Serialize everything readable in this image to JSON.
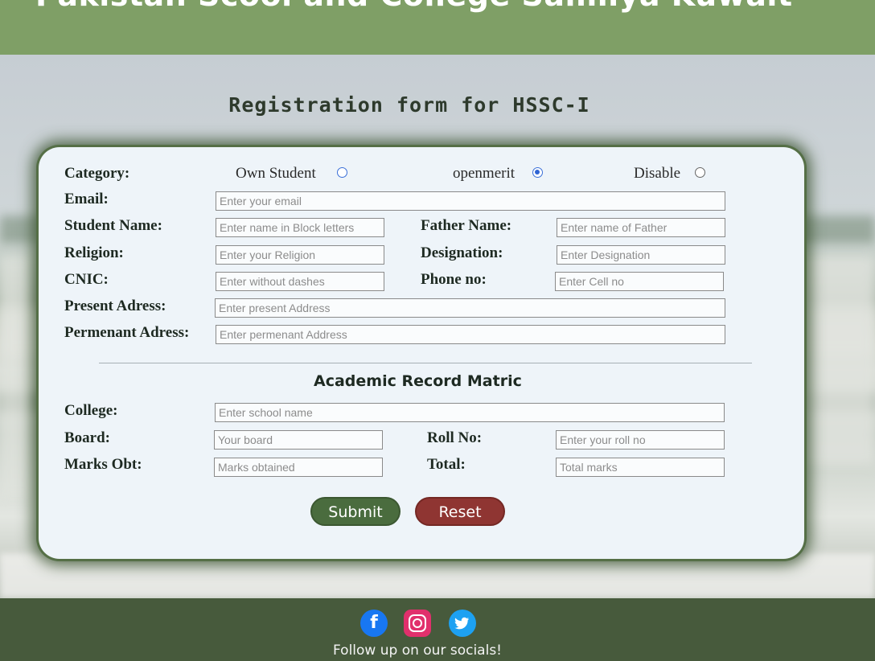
{
  "header": {
    "title": "Pakistan Scool and College Salmiya Kuwait"
  },
  "form": {
    "title": "Registration form for HSSC-I",
    "category": {
      "label": "Category:",
      "options": [
        {
          "label": "Own Student",
          "checked": false
        },
        {
          "label": "openmerit",
          "checked": true
        },
        {
          "label": "Disable",
          "checked": false
        }
      ]
    },
    "fields": {
      "email": {
        "label": "Email:",
        "placeholder": "Enter your email"
      },
      "student_name": {
        "label": "Student Name:",
        "placeholder": "Enter name in Block letters"
      },
      "father_name": {
        "label": "Father Name:",
        "placeholder": "Enter name of Father"
      },
      "religion": {
        "label": "Religion:",
        "placeholder": "Enter your Religion"
      },
      "designation": {
        "label": "Designation:",
        "placeholder": "Enter Designation"
      },
      "cnic": {
        "label": "CNIC:",
        "placeholder": "Enter without dashes"
      },
      "phone": {
        "label": "Phone no:",
        "placeholder": "Enter Cell no"
      },
      "present_address": {
        "label": "Present Adress:",
        "placeholder": "Enter present Address"
      },
      "permanent_address": {
        "label": "Permenant Adress:",
        "placeholder": "Enter permenant Address"
      }
    },
    "academic": {
      "title": "Academic Record Matric",
      "college": {
        "label": "College:",
        "placeholder": "Enter school name"
      },
      "board": {
        "label": "Board:",
        "placeholder": "Your board"
      },
      "roll_no": {
        "label": "Roll No:",
        "placeholder": "Enter your roll no"
      },
      "marks": {
        "label": "Marks Obt:",
        "placeholder": "Marks obtained"
      },
      "total": {
        "label": "Total:",
        "placeholder": "Total marks"
      }
    },
    "buttons": {
      "submit": "Submit",
      "reset": "Reset"
    }
  },
  "footer": {
    "socials": [
      {
        "name": "facebook-icon",
        "glyph": "f"
      },
      {
        "name": "instagram-icon",
        "glyph": ""
      },
      {
        "name": "twitter-icon",
        "glyph": "🐦"
      }
    ],
    "text": "Follow up on our socials!"
  },
  "colors": {
    "header": "#7f9f66",
    "footer": "#475a3c",
    "submit": "#4a6c3e",
    "reset": "#8f3532",
    "card": "#eef4f9"
  }
}
